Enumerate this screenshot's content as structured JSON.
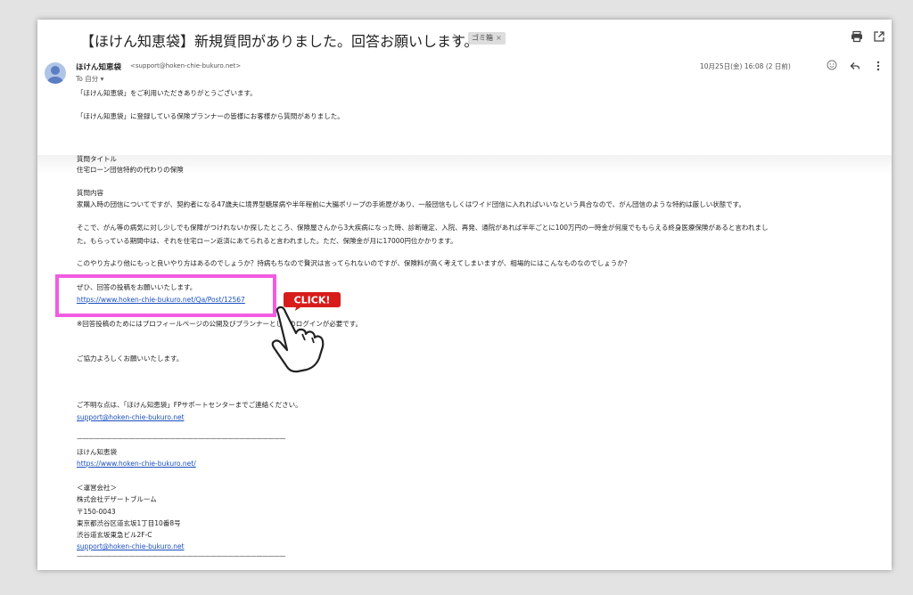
{
  "header": {
    "subject": "【ほけん知恵袋】新規質問がありました。回答お願いします。",
    "important_icon": "important-marker-icon",
    "label": "ゴミ箱",
    "label_close": "×",
    "print_icon": "print-icon",
    "popout_icon": "open-in-new-window-icon"
  },
  "sender": {
    "name": "ほけん知恵袋",
    "email": "<support@hoken-chie-bukuro.net>",
    "to": "To 自分 ▾",
    "date": "10月25日(金) 16:08 (2 日前)",
    "avatar_icon": "person-avatar-icon"
  },
  "actions": {
    "emoji_icon": "emoji-reaction-icon",
    "reply_icon": "reply-icon",
    "more_icon": "more-vertical-icon"
  },
  "body": {
    "greeting": "「ほけん知恵袋」をご利用いただきありがとうございます。",
    "intro": "「ほけん知恵袋」に登録している保険プランナーの皆様にお客様から質問がありました。",
    "title_label": "質問タイトル",
    "title_value": "住宅ローン団信特約の代わりの保険",
    "content_label": "質問内容",
    "content_1": "家購入時の団信についてですが、契約者になる47歳夫に境界型糖尿病や半年程前に大腸ポリープの手術歴があり、一般団信もしくはワイド団信に入れればいいなという具合なので、がん団信のような特約は厳しい状態です。",
    "content_2a": "そこで、がん等の病気に対し少しでも保障がつけれないか探したところ、保険屋さんから3大疾病になった時、診断確定、入院、再発、通院があれば半年ごとに100万円の一時金が何度でももらえる終身医療保険があると言われまし",
    "content_2b": "た。もらっている期間中は、それを住宅ローン返済にあてられると言われました。ただ、保険金が月に17000円位かかります。",
    "content_3": "このやり方より他にもっと良いやり方はあるのでしょうか？持病もちなので贅沢は言ってられないのですが、保険料が高く考えてしまいますが、相場的にはこんなものなのでしょうか？",
    "request": "ぜひ、回答の投稿をお願いいたします。",
    "answer_link": "https://www.hoken-chie-bukuro.net/Qa/Post/12567",
    "login_note": "※回答投稿のためにはプロフィールページの公開及びプランナーとしてのログインが必要です。",
    "closing": "ご協力よろしくお願いいたします。",
    "contact_note": "ご不明な点は、「ほけん知恵袋」FPサポートセンターまでご連絡ください。",
    "contact_email": "support@hoken-chie-bukuro.net",
    "divider": "————————————————————————————————————",
    "signature_name": "ほけん知恵袋",
    "signature_url": "https://www.hoken-chie-bukuro.net/",
    "operator_label": "＜運営会社＞",
    "company": "株式会社デザートブルーム",
    "postal": "〒150-0043",
    "address_1": "東京都渋谷区道玄坂1丁目10番8号",
    "address_2": "渋谷道玄坂東急ビル2F-C",
    "signature_email": "support@hoken-chie-bukuro.net"
  },
  "overlay": {
    "click_label": "CLICK!",
    "highlight_color": "#f25ce1",
    "click_color": "#d81c1c",
    "hand_icon": "pointing-hand-icon"
  }
}
